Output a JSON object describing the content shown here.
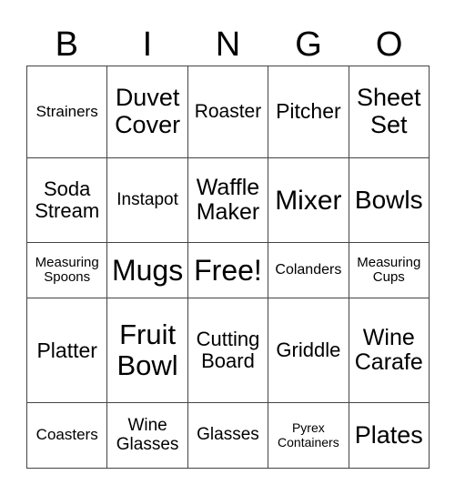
{
  "header": [
    "B",
    "I",
    "N",
    "G",
    "O"
  ],
  "cells": [
    [
      "Strainers",
      "Duvet Cover",
      "Roaster",
      "Pitcher",
      "Sheet Set"
    ],
    [
      "Soda Stream",
      "Instapot",
      "Waffle Maker",
      "Mixer",
      "Bowls"
    ],
    [
      "Measuring Spoons",
      "Mugs",
      "Free!",
      "Colanders",
      "Measuring Cups"
    ],
    [
      "Platter",
      "Fruit Bowl",
      "Cutting Board",
      "Griddle",
      "Wine Carafe"
    ],
    [
      "Coasters",
      "Wine Glasses",
      "Glasses",
      "Pyrex Containers",
      "Plates"
    ]
  ]
}
